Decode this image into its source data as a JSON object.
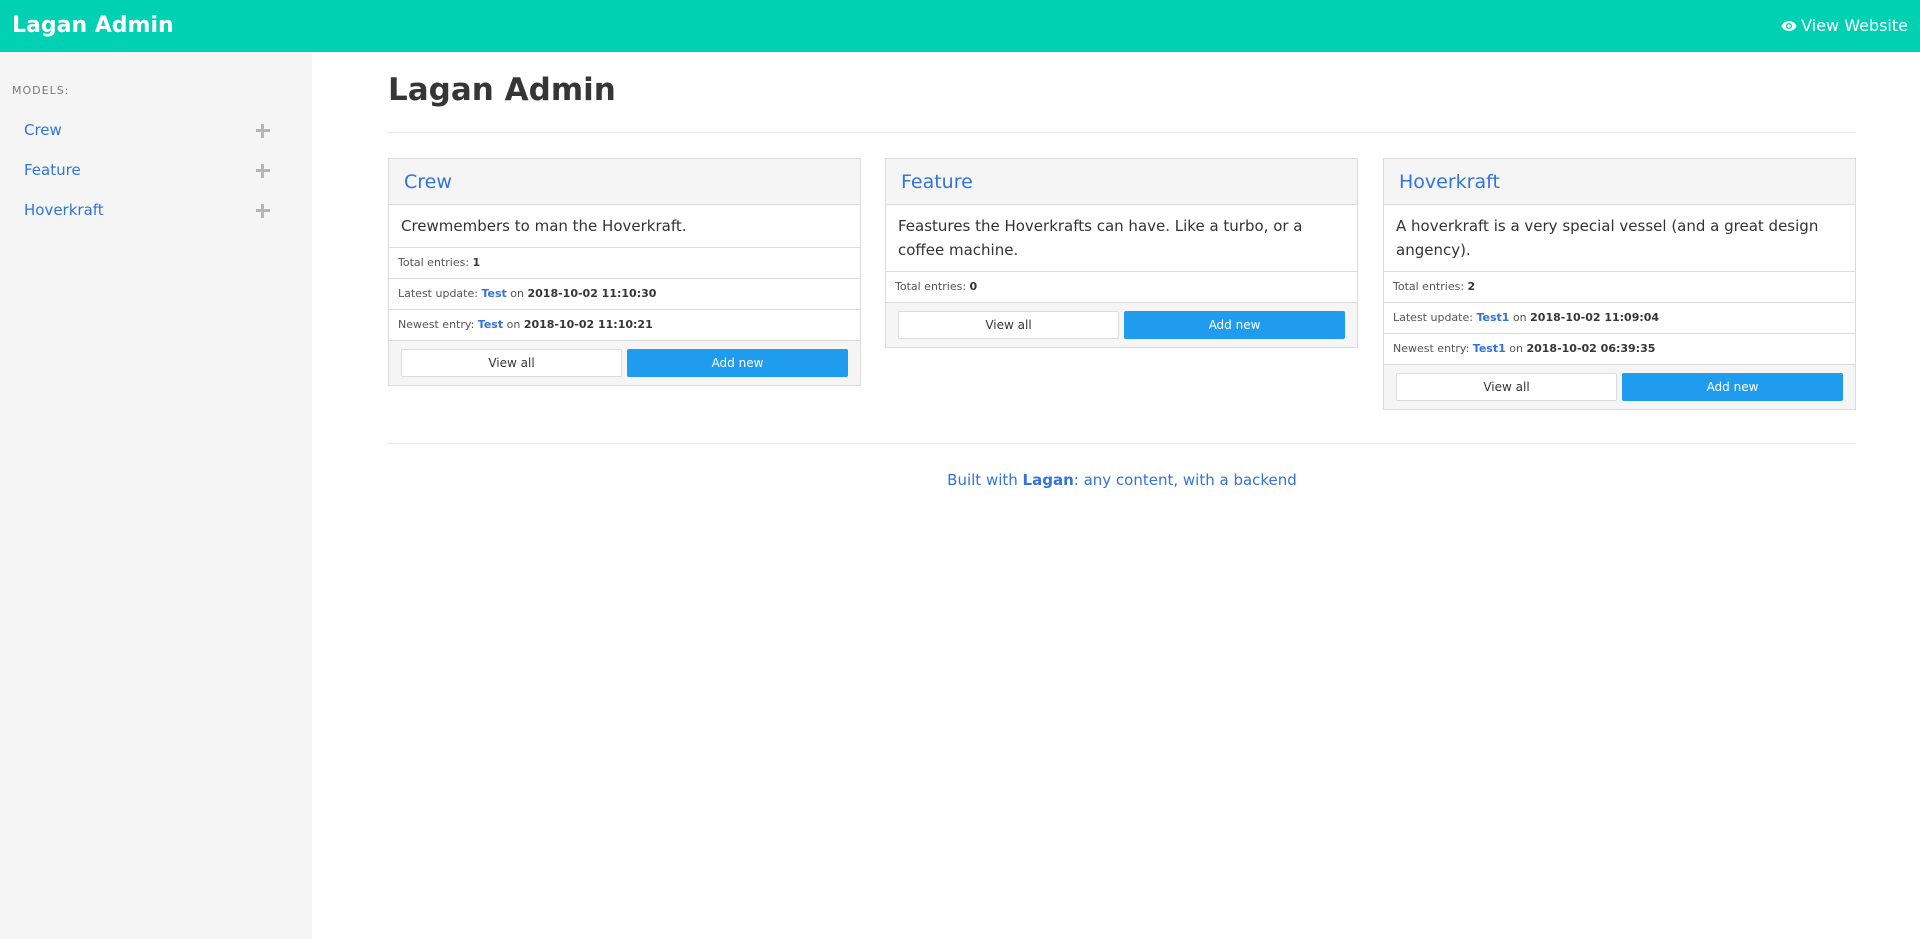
{
  "header": {
    "brand": "Lagan Admin",
    "view_website": "View Website",
    "bg_color": "#00d1b2"
  },
  "sidebar": {
    "section_label": "MODELS:",
    "items": [
      {
        "label": "Crew"
      },
      {
        "label": "Feature"
      },
      {
        "label": "Hoverkraft"
      }
    ]
  },
  "main": {
    "title": "Lagan Admin",
    "cards": [
      {
        "title": "Crew",
        "description": "Crewmembers to man the Hoverkraft.",
        "total_label": "Total entries:",
        "total": "1",
        "latest_label": "Latest update:",
        "latest_name": "Test",
        "latest_on": "on",
        "latest_date": "2018-10-02 11:10:30",
        "newest_label": "Newest entry:",
        "newest_name": "Test",
        "newest_on": "on",
        "newest_date": "2018-10-02 11:10:21",
        "view_all": "View all",
        "add_new": "Add new"
      },
      {
        "title": "Feature",
        "description": "Feastures the Hoverkrafts can have. Like a turbo, or a coffee machine.",
        "total_label": "Total entries:",
        "total": "0",
        "view_all": "View all",
        "add_new": "Add new"
      },
      {
        "title": "Hoverkraft",
        "description": "A hoverkraft is a very special vessel (and a great design angency).",
        "total_label": "Total entries:",
        "total": "2",
        "latest_label": "Latest update:",
        "latest_name": "Test1",
        "latest_on": "on",
        "latest_date": "2018-10-02 11:09:04",
        "newest_label": "Newest entry:",
        "newest_name": "Test1",
        "newest_on": "on",
        "newest_date": "2018-10-02 06:39:35",
        "view_all": "View all",
        "add_new": "Add new"
      }
    ]
  },
  "footer": {
    "prefix": "Built with ",
    "brand": "Lagan",
    "suffix": ": any content, with a backend"
  },
  "colors": {
    "accent": "#00d1b2",
    "link": "#3273dc",
    "button_primary": "#209cee"
  },
  "icons": {
    "view_website": "eye-icon",
    "add_model": "plus-icon"
  }
}
